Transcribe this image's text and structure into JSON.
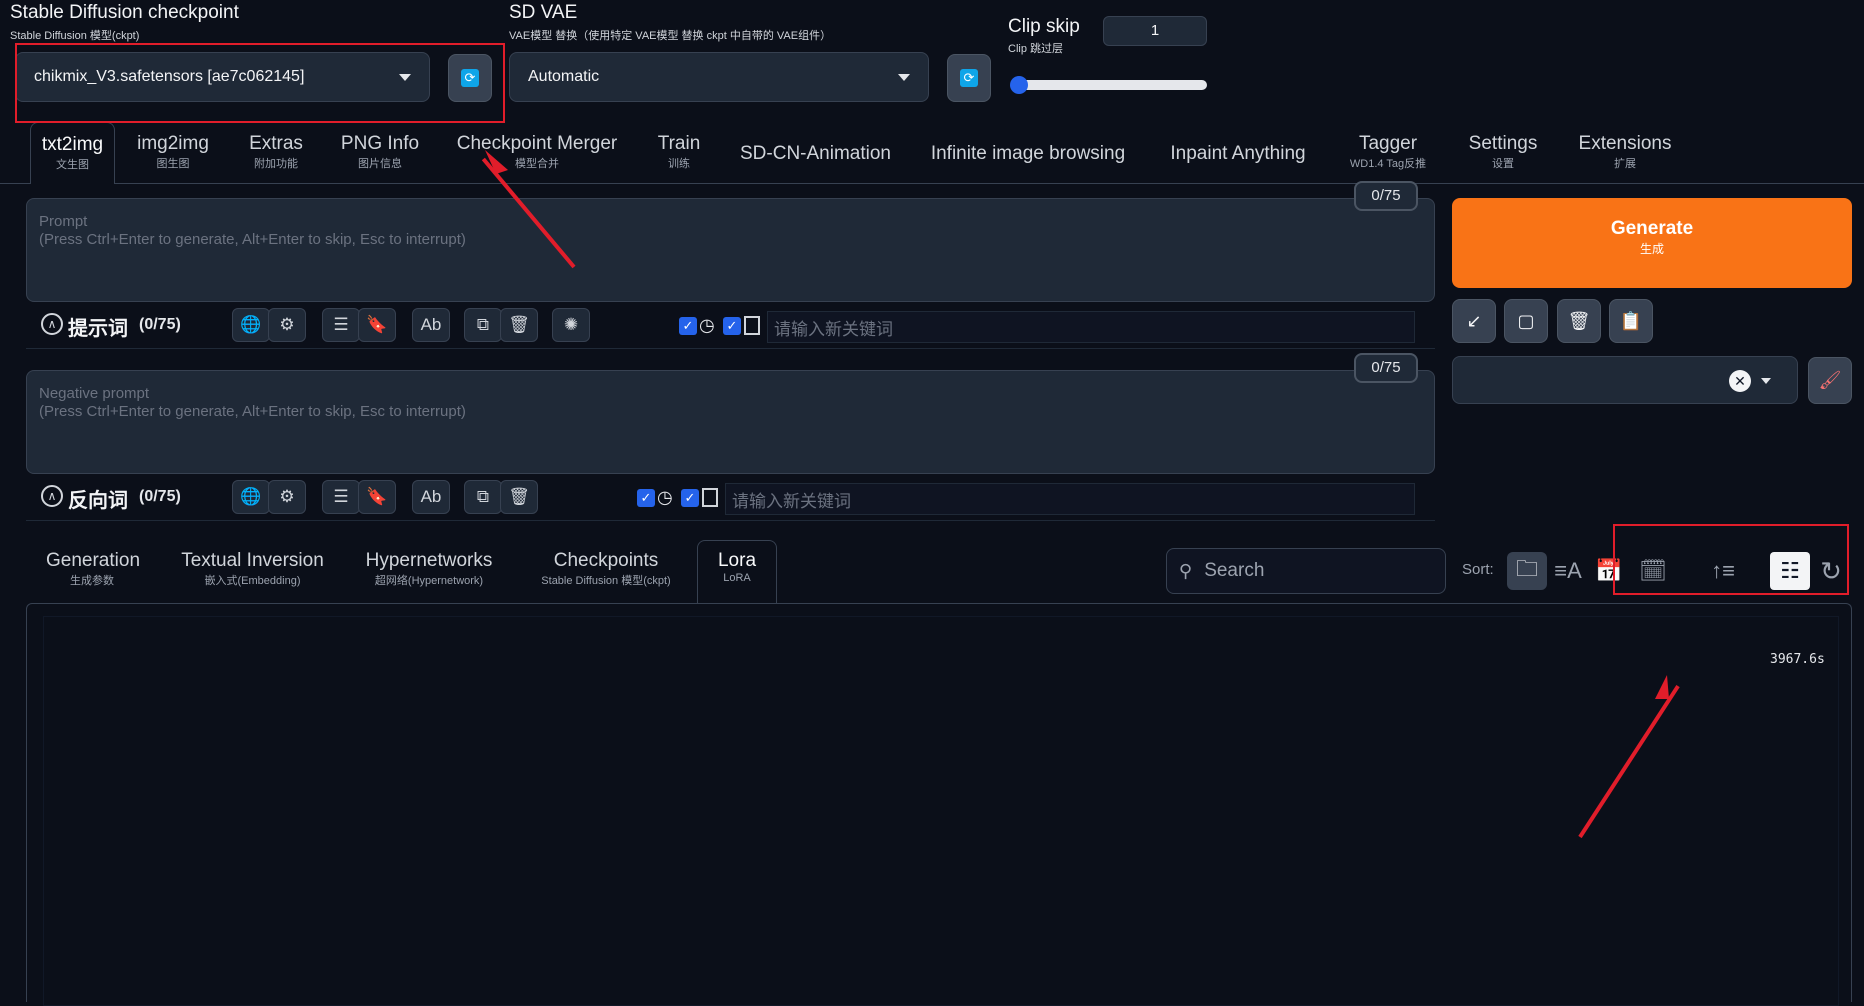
{
  "checkpoint": {
    "title": "Stable Diffusion checkpoint",
    "subtitle": "Stable Diffusion 模型(ckpt)",
    "value": "chikmix_V3.safetensors [ae7c062145]"
  },
  "vae": {
    "title": "SD VAE",
    "subtitle": "VAE模型 替换（使用特定 VAE模型 替换 ckpt 中自带的 VAE组件）",
    "value": "Automatic"
  },
  "clip_skip": {
    "title": "Clip skip",
    "subtitle": "Clip 跳过层",
    "value": "1",
    "slider_fraction": 0.0
  },
  "tabs": [
    {
      "label": "txt2img",
      "sub": "文生图"
    },
    {
      "label": "img2img",
      "sub": "图生图"
    },
    {
      "label": "Extras",
      "sub": "附加功能"
    },
    {
      "label": "PNG Info",
      "sub": "图片信息"
    },
    {
      "label": "Checkpoint Merger",
      "sub": "模型合并"
    },
    {
      "label": "Train",
      "sub": "训练"
    },
    {
      "label": "SD-CN-Animation",
      "sub": ""
    },
    {
      "label": "Infinite image browsing",
      "sub": ""
    },
    {
      "label": "Inpaint Anything",
      "sub": ""
    },
    {
      "label": "Tagger",
      "sub": "WD1.4 Tag反推"
    },
    {
      "label": "Settings",
      "sub": "设置"
    },
    {
      "label": "Extensions",
      "sub": "扩展"
    }
  ],
  "prompt": {
    "placeholder_line1": "Prompt",
    "placeholder_line2": "(Press Ctrl+Enter to generate, Alt+Enter to skip, Esc to interrupt)",
    "counter": "0/75",
    "toolbar_title": "提示词",
    "toolbar_count": "(0/75)",
    "keyword_placeholder": "请输入新关键词"
  },
  "negative_prompt": {
    "placeholder_line1": "Negative prompt",
    "placeholder_line2": "(Press Ctrl+Enter to generate, Alt+Enter to skip, Esc to interrupt)",
    "counter": "0/75",
    "toolbar_title": "反向词",
    "toolbar_count": "(0/75)",
    "keyword_placeholder": "请输入新关键词"
  },
  "generate": {
    "label": "Generate",
    "sub": "生成"
  },
  "extra_tabs": [
    {
      "label": "Generation",
      "sub": "生成参数"
    },
    {
      "label": "Textual Inversion",
      "sub": "嵌入式(Embedding)"
    },
    {
      "label": "Hypernetworks",
      "sub": "超网络(Hypernetwork)"
    },
    {
      "label": "Checkpoints",
      "sub": "Stable Diffusion 模型(ckpt)"
    },
    {
      "label": "Lora",
      "sub": "LoRA"
    }
  ],
  "search": {
    "placeholder": "Search"
  },
  "sort_label": "Sort:",
  "timer": "3967.6s",
  "colors": {
    "background": "#0b0f19",
    "accent_orange": "#f97316",
    "annotation_red": "#e11d2a",
    "checkbox_blue": "#2563eb"
  }
}
